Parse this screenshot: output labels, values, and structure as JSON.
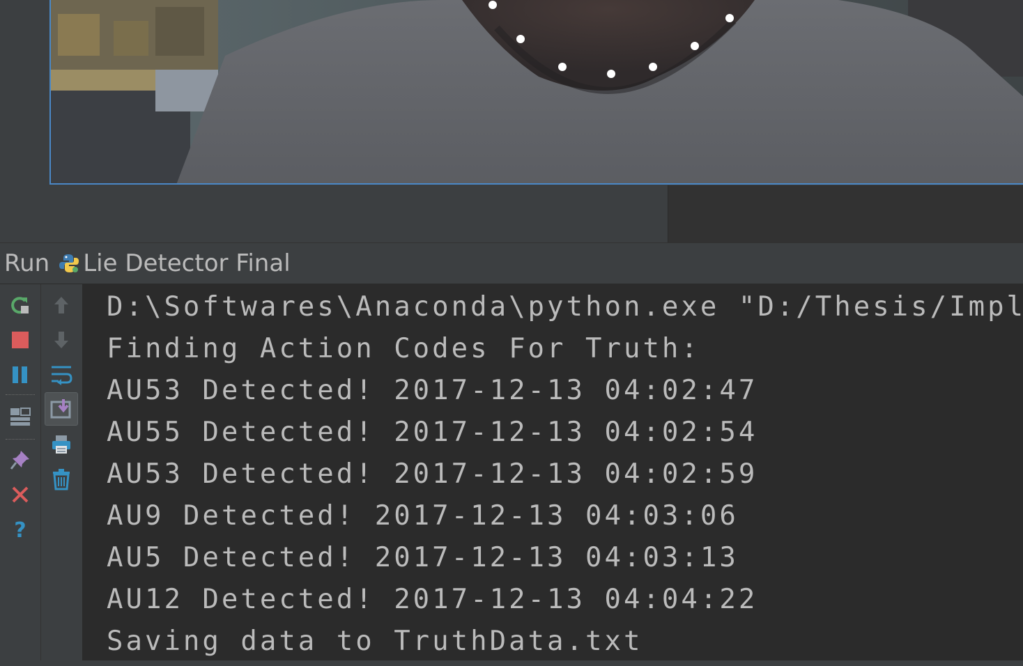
{
  "video": {
    "content": "webcam frame with facial landmark points along the jawline"
  },
  "run_panel": {
    "run_label": "Run",
    "config_icon": "python-icon",
    "config_name": "Lie Detector Final"
  },
  "toolbar_left": [
    {
      "icon": "rerun-icon",
      "color": "#59a869"
    },
    {
      "icon": "stop-icon",
      "color": "#db5c5c"
    },
    {
      "icon": "pause-icon",
      "color": "#3592c4"
    },
    {
      "icon": "restore-layout-icon"
    },
    {
      "icon": "pin-icon"
    },
    {
      "icon": "close-icon",
      "color": "#db5c5c"
    },
    {
      "icon": "help-icon",
      "color": "#3592c4"
    }
  ],
  "toolbar_right": [
    {
      "icon": "up-arrow-icon"
    },
    {
      "icon": "down-arrow-icon"
    },
    {
      "icon": "soft-wrap-icon"
    },
    {
      "icon": "scroll-to-end-icon",
      "pressed": true
    },
    {
      "icon": "print-icon"
    },
    {
      "icon": "clear-all-icon"
    }
  ],
  "console": {
    "lines": [
      "D:\\Softwares\\Anaconda\\python.exe \"D:/Thesis/Imple",
      "Finding Action Codes For Truth:",
      "AU53 Detected! 2017-12-13 04:02:47",
      "AU55 Detected! 2017-12-13 04:02:54",
      "AU53 Detected! 2017-12-13 04:02:59",
      "AU9 Detected! 2017-12-13 04:03:06",
      "AU5 Detected! 2017-12-13 04:03:13",
      "AU12 Detected! 2017-12-13 04:04:22",
      "Saving data to TruthData.txt"
    ]
  }
}
